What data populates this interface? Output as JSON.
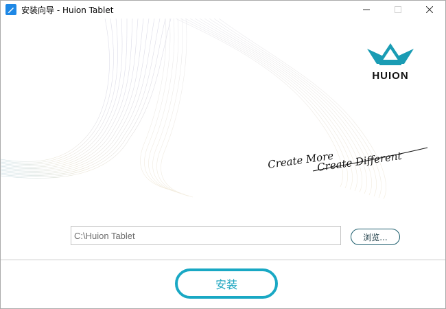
{
  "window": {
    "title": "安装向导 - Huion Tablet",
    "controls": [
      "minimize",
      "maximize",
      "close"
    ]
  },
  "banner": {
    "brand": "HUION",
    "tagline_line1": "Create More",
    "tagline_line2": "Create Different",
    "brand_color": "#1a9cb4"
  },
  "install": {
    "path_value": "C:\\Huion Tablet",
    "browse_label": "浏览...",
    "install_label": "安装"
  },
  "colors": {
    "accent": "#19a8c4",
    "browse_border": "#1b5c6c"
  }
}
